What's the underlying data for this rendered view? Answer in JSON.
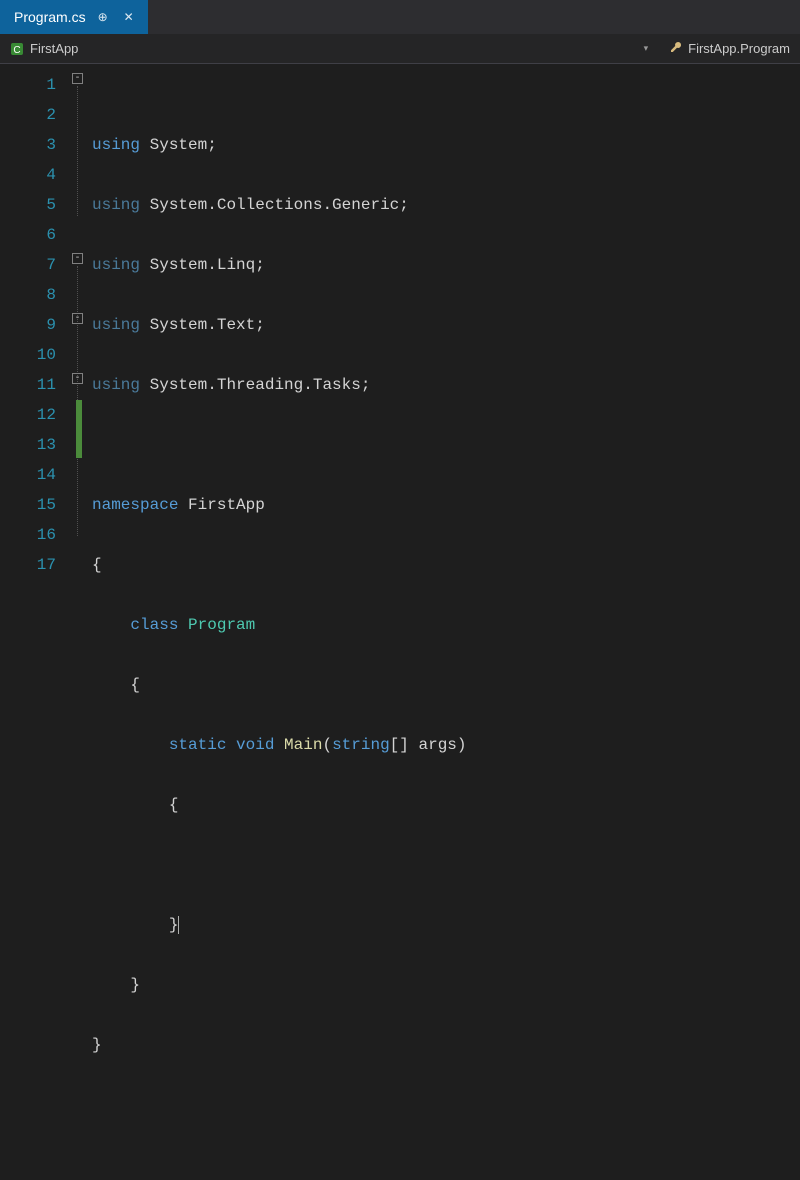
{
  "tab": {
    "filename": "Program.cs"
  },
  "nav": {
    "project": "FirstApp",
    "scope": "FirstApp.Program"
  },
  "lines": {
    "l1": "1",
    "l2": "2",
    "l3": "3",
    "l4": "4",
    "l5": "5",
    "l6": "6",
    "l7": "7",
    "l8": "8",
    "l9": "9",
    "l10": "10",
    "l11": "11",
    "l12": "12",
    "l13": "13",
    "l14": "14",
    "l15": "15",
    "l16": "16",
    "l17": "17"
  },
  "code": {
    "using": "using",
    "namespace": "namespace",
    "class": "class",
    "static": "static",
    "void": "void",
    "System": "System",
    "CollectionsGeneric": "System.Collections.Generic",
    "Linq": "System.Linq",
    "Text": "System.Text",
    "ThreadingTasks": "System.Threading.Tasks",
    "FirstApp": "FirstApp",
    "Program": "Program",
    "Main": "Main",
    "string": "string",
    "args": "args",
    "semi": ";",
    "lbrace": "{",
    "rbrace": "}",
    "lbrack": "[]",
    "lparen": "(",
    "rparen": ")"
  },
  "fold": {
    "minus": "-"
  }
}
